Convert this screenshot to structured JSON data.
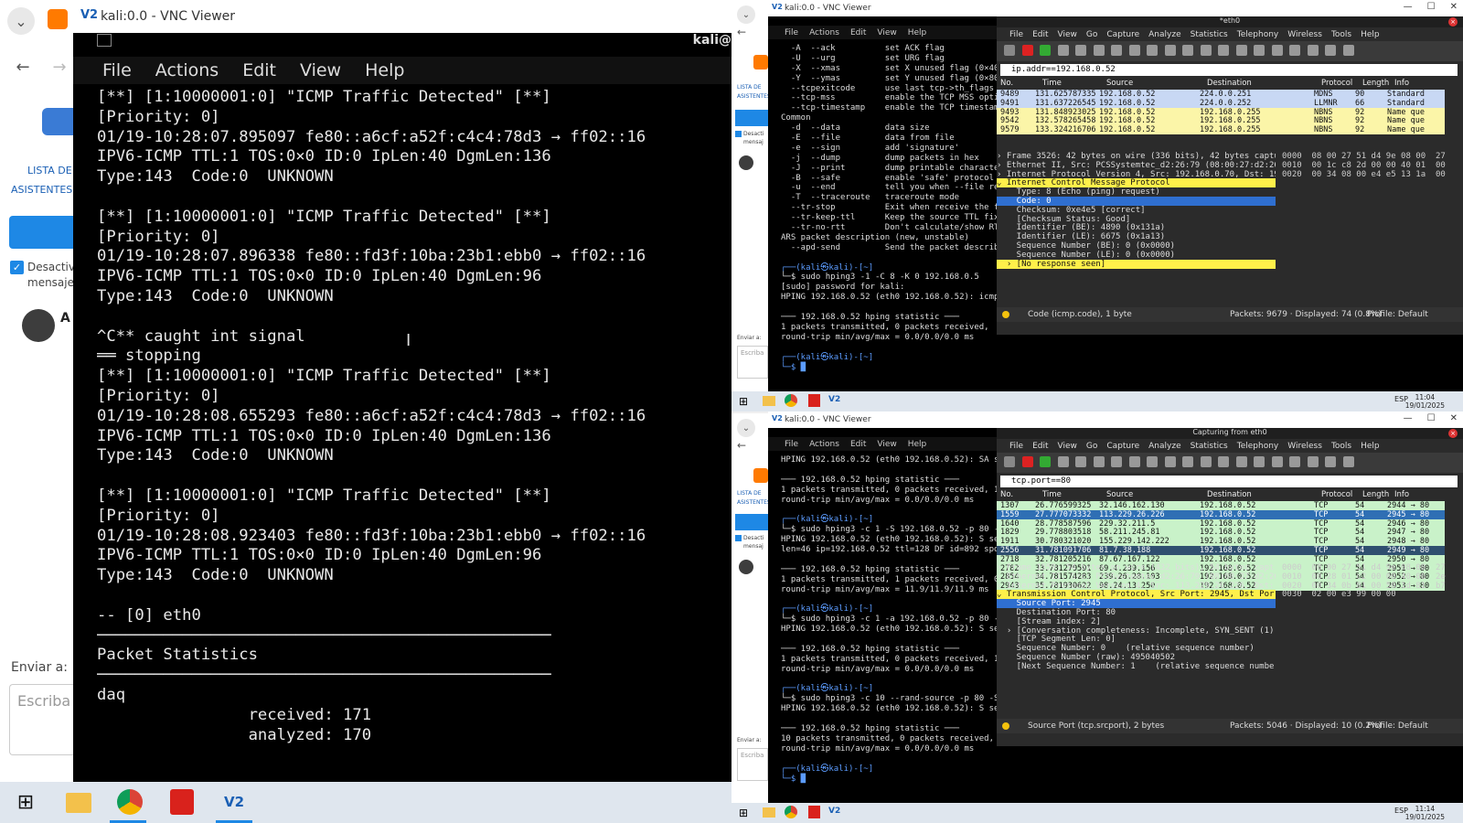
{
  "left_web": {
    "lista_label": "LISTA DE",
    "asistentes_label": "ASISTENTES A",
    "desactiv_label": "Desactiv",
    "mensaje_label": "mensaje",
    "avatar_initial": "A",
    "enviar_label": "Enviar a:",
    "escriba_placeholder": "Escriba"
  },
  "vnc_main": {
    "title": "kali:0.0 - VNC Viewer",
    "menu": [
      "File",
      "Actions",
      "Edit",
      "View",
      "Help"
    ],
    "host_label": "kali@",
    "lines": [
      "[**] [1:10000001:0] \"ICMP Traffic Detected\" [**]",
      "[Priority: 0]",
      "01/19-10:28:07.895097 fe80::a6cf:a52f:c4c4:78d3 → ff02::16",
      "IPV6-ICMP TTL:1 TOS:0×0 ID:0 IpLen:40 DgmLen:136",
      "Type:143  Code:0  UNKNOWN",
      "",
      "[**] [1:10000001:0] \"ICMP Traffic Detected\" [**]",
      "[Priority: 0]",
      "01/19-10:28:07.896338 fe80::fd3f:10ba:23b1:ebb0 → ff02::16",
      "IPV6-ICMP TTL:1 TOS:0×0 ID:0 IpLen:40 DgmLen:96",
      "Type:143  Code:0  UNKNOWN",
      "",
      "^C** caught int signal",
      "══ stopping",
      "[**] [1:10000001:0] \"ICMP Traffic Detected\" [**]",
      "[Priority: 0]",
      "01/19-10:28:08.655293 fe80::a6cf:a52f:c4c4:78d3 → ff02::16",
      "IPV6-ICMP TTL:1 TOS:0×0 ID:0 IpLen:40 DgmLen:136",
      "Type:143  Code:0  UNKNOWN",
      "",
      "[**] [1:10000001:0] \"ICMP Traffic Detected\" [**]",
      "[Priority: 0]",
      "01/19-10:28:08.923403 fe80::fd3f:10ba:23b1:ebb0 → ff02::16",
      "IPV6-ICMP TTL:1 TOS:0×0 ID:0 IpLen:40 DgmLen:96",
      "Type:143  Code:0  UNKNOWN",
      "",
      "-- [0] eth0",
      "────────────────────────────────────────────────",
      "Packet Statistics",
      "────────────────────────────────────────────────",
      "daq",
      "                received: 171",
      "                analyzed: 170"
    ]
  },
  "top_right": {
    "title": "kali:0.0 - VNC Viewer",
    "kali_menu": [
      "File",
      "Actions",
      "Edit",
      "View",
      "Help"
    ],
    "terminal_lines": [
      "  -A  --ack          set ACK flag",
      "  -U  --urg          set URG flag",
      "  -X  --xmas         set X unused flag (0×40)",
      "  -Y  --ymas         set Y unused flag (0×80)",
      "  --tcpexitcode      use last tcp->th_flags as",
      "  --tcp-mss          enable the TCP MSS option",
      "  --tcp-timestamp    enable the TCP timestamp",
      "Common",
      "  -d  --data         data size",
      "  -E  --file         data from file",
      "  -e  --sign         add 'signature'",
      "  -j  --dump         dump packets in hex",
      "  -J  --print        dump printable characters",
      "  -B  --safe         enable 'safe' protocol",
      "  -u  --end          tell you when --file reach",
      "  -T  --traceroute   traceroute mode",
      "  --tr-stop          Exit when receive the fir",
      "  --tr-keep-ttl      Keep the source TTL fixed",
      "  --tr-no-rtt        Don't calculate/show RTT",
      "ARS packet description (new, unstable)",
      "  --apd-send         Send the packet described",
      "",
      "┌──(kali㉿kali)-[~]",
      "└─$ sudo hping3 -1 -C 8 -K 0 192.168.0.5",
      "[sudo] password for kali:",
      "HPING 192.168.0.52 (eth0 192.168.0.52): icmp",
      "",
      "─── 192.168.0.52 hping statistic ───",
      "1 packets transmitted, 0 packets received,",
      "round-trip min/avg/max = 0.0/0.0/0.0 ms",
      "",
      "┌──(kali㉿kali)-[~]",
      "└─$ █"
    ],
    "ws": {
      "title": "*eth0",
      "menu": [
        "File",
        "Edit",
        "View",
        "Go",
        "Capture",
        "Analyze",
        "Statistics",
        "Telephony",
        "Wireless",
        "Tools",
        "Help"
      ],
      "filter": "ip.addr==192.168.0.52",
      "columns": [
        "No.",
        "Time",
        "Source",
        "Destination",
        "Protocol",
        "Length",
        "Info"
      ],
      "packets": [
        {
          "no": "9489",
          "time": "131.625787335",
          "src": "192.168.0.52",
          "dst": "224.0.0.251",
          "proto": "MDNS",
          "len": "90",
          "info": "Standard",
          "bg": "#c8d8f4"
        },
        {
          "no": "9491",
          "time": "131.637226545",
          "src": "192.168.0.52",
          "dst": "224.0.0.252",
          "proto": "LLMNR",
          "len": "66",
          "info": "Standard",
          "bg": "#c8d8f4"
        },
        {
          "no": "9493",
          "time": "131.848923025",
          "src": "192.168.0.52",
          "dst": "192.168.0.255",
          "proto": "NBNS",
          "len": "92",
          "info": "Name que",
          "bg": "#fbf5a8"
        },
        {
          "no": "9542",
          "time": "132.578265458",
          "src": "192.168.0.52",
          "dst": "192.168.0.255",
          "proto": "NBNS",
          "len": "92",
          "info": "Name que",
          "bg": "#fbf5a8"
        },
        {
          "no": "9579",
          "time": "133.324216706",
          "src": "192.168.0.52",
          "dst": "192.168.0.255",
          "proto": "NBNS",
          "len": "92",
          "info": "Name que",
          "bg": "#fbf5a8"
        }
      ],
      "details": [
        "› Frame 3526: 42 bytes on wire (336 bits), 42 bytes captu",
        "› Ethernet II, Src: PCSSystemtec_d2:26:79 (08:00:27:d2:26",
        "› Internet Protocol Version 4, Src: 192.168.0.70, Dst: 19",
        "⌄ Internet Control Message Protocol",
        "    Type: 8 (Echo (ping) request)",
        "    Code: 0",
        "    Checksum: 0xe4e5 [correct]",
        "    [Checksum Status: Good]",
        "    Identifier (BE): 4890 (0x131a)",
        "    Identifier (LE): 6675 (0x1a13)",
        "    Sequence Number (BE): 0 (0x0000)",
        "    Sequence Number (LE): 0 (0x0000)",
        "  › [No response seen]"
      ],
      "hex": [
        "0000  08 00 27 51 d4 9e 08 00  27",
        "0010  00 1c c8 2d 00 00 40 01  00",
        "0020  00 34 08 00 e4 e5 13 1a  00"
      ],
      "status_field": "Code (icmp.code), 1 byte",
      "status_packets": "Packets: 9679 · Displayed: 74 (0.8%)",
      "status_profile": "Profile: Default"
    },
    "clock_time": "11:04",
    "clock_date": "19/01/2025",
    "tray_lang": "ESP"
  },
  "bottom_right": {
    "title": "kali:0.0 - VNC Viewer",
    "kali_menu": [
      "File",
      "Actions",
      "Edit",
      "View",
      "Help"
    ],
    "terminal_lines": [
      "HPING 192.168.0.52 (eth0 192.168.0.52): SA se",
      "",
      "─── 192.168.0.52 hping statistic ───",
      "1 packets transmitted, 0 packets received, 1",
      "round-trip min/avg/max = 0.0/0.0/0.0 ms",
      "",
      "┌──(kali㉿kali)-[~]",
      "└─$ sudo hping3 -c 1 -S 192.168.0.52 -p 80 -",
      "HPING 192.168.0.52 (eth0 192.168.0.52): S se",
      "len=46 ip=192.168.0.52 ttl=128 DF id=892 spo",
      "",
      "─── 192.168.0.52 hping statistic ───",
      "1 packets transmitted, 1 packets received, 0",
      "round-trip min/avg/max = 11.9/11.9/11.9 ms",
      "",
      "┌──(kali㉿kali)-[~]",
      "└─$ sudo hping3 -c 1 -a 192.168.0.52 -p 80 -",
      "HPING 192.168.0.52 (eth0 192.168.0.52): S se",
      "",
      "─── 192.168.0.52 hping statistic ───",
      "1 packets transmitted, 0 packets received, 1",
      "round-trip min/avg/max = 0.0/0.0/0.0 ms",
      "",
      "┌──(kali㉿kali)-[~]",
      "└─$ sudo hping3 -c 10 --rand-source -p 80 -S",
      "HPING 192.168.0.52 (eth0 192.168.0.52): S se",
      "",
      "─── 192.168.0.52 hping statistic ───",
      "10 packets transmitted, 0 packets received, 100% packet loss",
      "round-trip min/avg/max = 0.0/0.0/0.0 ms",
      "",
      "┌──(kali㉿kali)-[~]",
      "└─$ █"
    ],
    "ws": {
      "title": "Capturing from eth0",
      "menu": [
        "File",
        "Edit",
        "View",
        "Go",
        "Capture",
        "Analyze",
        "Statistics",
        "Telephony",
        "Wireless",
        "Tools",
        "Help"
      ],
      "filter": "tcp.port==80",
      "columns": [
        "No.",
        "Time",
        "Source",
        "Destination",
        "Protocol",
        "Length",
        "Info"
      ],
      "packets": [
        {
          "no": "1307",
          "time": "26.776599325",
          "src": "32.146.162.130",
          "dst": "192.168.0.52",
          "proto": "TCP",
          "len": "54",
          "info": "2944 → 80",
          "bg": "#c9f2c9"
        },
        {
          "no": "1559",
          "time": "27.777073332",
          "src": "113.229.26.226",
          "dst": "192.168.0.52",
          "proto": "TCP",
          "len": "54",
          "info": "2945 → 80",
          "bg": "#2f6fb4"
        },
        {
          "no": "1640",
          "time": "28.778587596",
          "src": "229.32.211.5",
          "dst": "192.168.0.52",
          "proto": "TCP",
          "len": "54",
          "info": "2946 → 80",
          "bg": "#c9f2c9"
        },
        {
          "no": "1829",
          "time": "29.778803518",
          "src": "58.211.245.81",
          "dst": "192.168.0.52",
          "proto": "TCP",
          "len": "54",
          "info": "2947 → 80",
          "bg": "#c9f2c9"
        },
        {
          "no": "1911",
          "time": "30.780321020",
          "src": "155.229.142.222",
          "dst": "192.168.0.52",
          "proto": "TCP",
          "len": "54",
          "info": "2948 → 80",
          "bg": "#c9f2c9"
        },
        {
          "no": "2556",
          "time": "31.781091706",
          "src": "81.7.38.188",
          "dst": "192.168.0.52",
          "proto": "TCP",
          "len": "54",
          "info": "2949 → 80",
          "bg": "#2f4f6f"
        },
        {
          "no": "2718",
          "time": "32.781205216",
          "src": "87.67.167.122",
          "dst": "192.168.0.52",
          "proto": "TCP",
          "len": "54",
          "info": "2950 → 80",
          "bg": "#c9f2c9"
        },
        {
          "no": "2782",
          "time": "33.781279591",
          "src": "69.4.239.156",
          "dst": "192.168.0.52",
          "proto": "TCP",
          "len": "54",
          "info": "2951 → 80",
          "bg": "#c9f2c9"
        },
        {
          "no": "2854",
          "time": "34.781574283",
          "src": "239.26.28.103",
          "dst": "192.168.0.52",
          "proto": "TCP",
          "len": "54",
          "info": "2952 → 80",
          "bg": "#c9f2c9"
        },
        {
          "no": "2943",
          "time": "35.781930622",
          "src": "98.24.13.250",
          "dst": "192.168.0.52",
          "proto": "TCP",
          "len": "54",
          "info": "2953 → 80",
          "bg": "#c9f2c9"
        }
      ],
      "details": [
        "› Frame 1559: 54 bytes on wire (432 bits), 54 bytes capt",
        "› Ethernet II, Src: PCSSystemtec_d2:26:79 (08:00:27:d2:26",
        "› Internet Protocol Version 4, Src: 113.229.26.226, Dst:",
        "⌄ Transmission Control Protocol, Src Port: 2945, Dst Por",
        "    Source Port: 2945",
        "    Destination Port: 80",
        "    [Stream index: 2]",
        "  › [Conversation completeness: Incomplete, SYN_SENT (1)",
        "    [TCP Segment Len: 0]",
        "    Sequence Number: 0    (relative sequence number)",
        "    Sequence Number (raw): 495040502",
        "    [Next Sequence Number: 1    (relative sequence numbe"
      ],
      "hex": [
        "0000  08 00 27 51 d4 9e 08 00  27",
        "0010  00 28 01 c2 00 00 40 06  2e",
        "0020  00 34 0b 81 00 50 1d 81  b7",
        "0030  02 00 e3 99 00 00"
      ],
      "status_field": "Source Port (tcp.srcport), 2 bytes",
      "status_packets": "Packets: 5046 · Displayed: 10 (0.2%)",
      "status_profile": "Profile: Default"
    },
    "clock_time": "11:14",
    "clock_date": "19/01/2025",
    "tray_lang": "ESP"
  },
  "right_web": {
    "lista_label": "LISTA DE",
    "asistentes_label": "ASISTENTES",
    "desactiv_label": "Desacti",
    "mensaje_label": "mensaj",
    "enviar_label": "Enviar a:",
    "escriba_placeholder": "Escriba"
  },
  "colors": {
    "terminal_bg": "#000000",
    "terminal_fg": "#e8e8e8",
    "prompt_blue": "#5c9cff",
    "prompt_green": "#3fcf5f",
    "ws_bg": "#2b2b2b",
    "highlight_yellow": "#fff04a",
    "selection_blue": "#2f6fd0"
  }
}
